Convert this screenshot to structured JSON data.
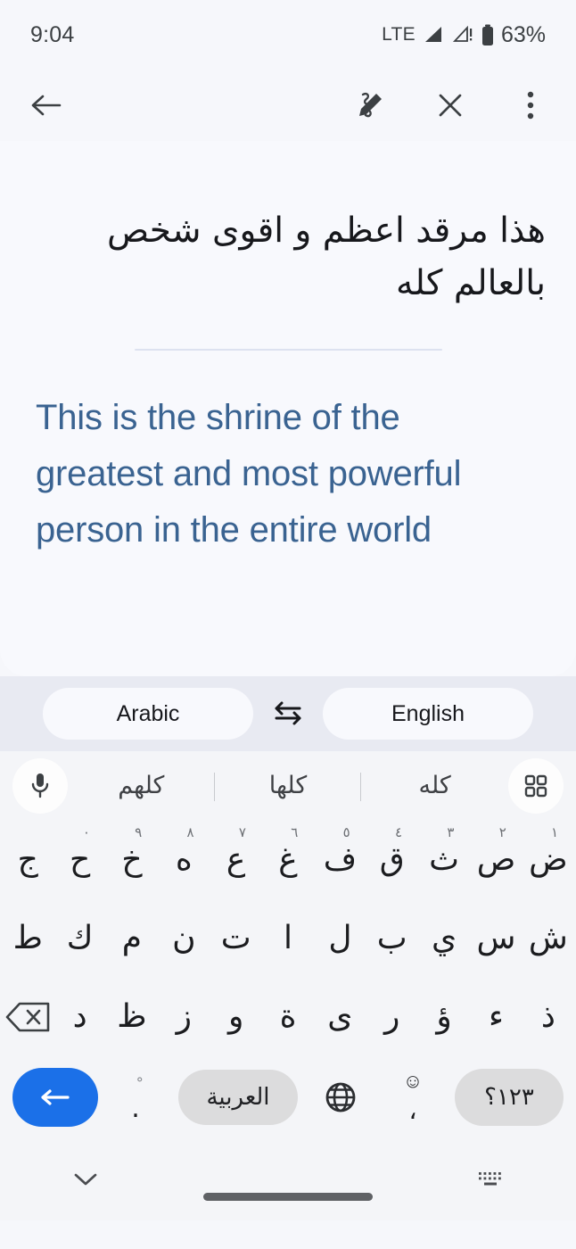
{
  "status_bar": {
    "time": "9:04",
    "network_type": "LTE",
    "battery_percent": "63%",
    "icons": [
      "signal-bars-icon",
      "signal-warning-icon",
      "battery-icon"
    ]
  },
  "toolbar": {
    "back_label": "back-arrow",
    "handwriting_label": "handwriting",
    "close_label": "close",
    "more_label": "more-options"
  },
  "translation": {
    "source_text": "هذا مرقد اعظم و اقوى شخص بالعالم كله",
    "target_text": "This is the shrine of the greatest and most powerful person in the entire world",
    "target_color": "#3a6391"
  },
  "language_bar": {
    "source_language": "Arabic",
    "target_language": "English",
    "swap_label": "swap-languages"
  },
  "keyboard": {
    "mic_label": "voice-input",
    "grid_label": "keyboard-menu",
    "suggestions": [
      "كله",
      "كلها",
      "كلهم"
    ],
    "row1": [
      {
        "glyph": "ض",
        "digit": "١"
      },
      {
        "glyph": "ص",
        "digit": "٢"
      },
      {
        "glyph": "ث",
        "digit": "٣"
      },
      {
        "glyph": "ق",
        "digit": "٤"
      },
      {
        "glyph": "ف",
        "digit": "٥"
      },
      {
        "glyph": "غ",
        "digit": "٦"
      },
      {
        "glyph": "ع",
        "digit": "٧"
      },
      {
        "glyph": "ه",
        "digit": "٨"
      },
      {
        "glyph": "خ",
        "digit": "٩"
      },
      {
        "glyph": "ح",
        "digit": "٠"
      },
      {
        "glyph": "ج",
        "digit": ""
      }
    ],
    "row2": [
      "ش",
      "س",
      "ي",
      "ب",
      "ل",
      "ا",
      "ت",
      "ن",
      "م",
      "ك",
      "ط"
    ],
    "row3": [
      "ذ",
      "ء",
      "ؤ",
      "ر",
      "ى",
      "ة",
      "و",
      "ز",
      "ظ",
      "د"
    ],
    "backspace_label": "backspace",
    "bottom_row": {
      "symbols_key": "١٢٣؟",
      "emoji_key": "☺",
      "comma_key": "،",
      "globe_key": "language-switch",
      "space_key": "العربية",
      "period_ring": "ْ",
      "period_key": ".",
      "enter_key": "enter",
      "enter_color": "#1b70e8"
    }
  },
  "nav_bar": {
    "hide_keyboard_label": "hide-keyboard",
    "home_label": "home-indicator",
    "switch_keyboard_label": "switch-keyboard"
  }
}
